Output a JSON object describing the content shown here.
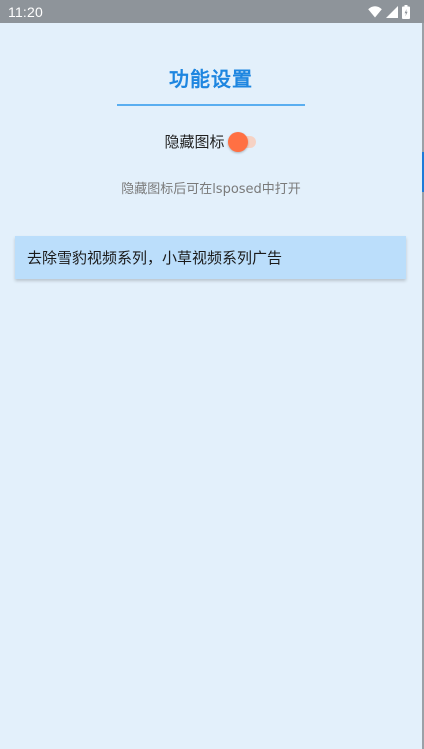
{
  "status_bar": {
    "time": "11:20",
    "icons": [
      "wifi-icon",
      "signal-icon",
      "battery-icon"
    ]
  },
  "page": {
    "title": "功能设置",
    "toggle_label": "隐藏图标",
    "toggle_on": false,
    "hint": "隐藏图标后可在lsposed中打开"
  },
  "features": [
    {
      "label": "去除雪豹视频系列，小草视频系列广告"
    }
  ],
  "colors": {
    "accent": "#1e86e0",
    "background": "#e3f0fb",
    "card": "#bbdefb",
    "switch_thumb": "#ff7043",
    "status_bar": "#8e949a"
  }
}
